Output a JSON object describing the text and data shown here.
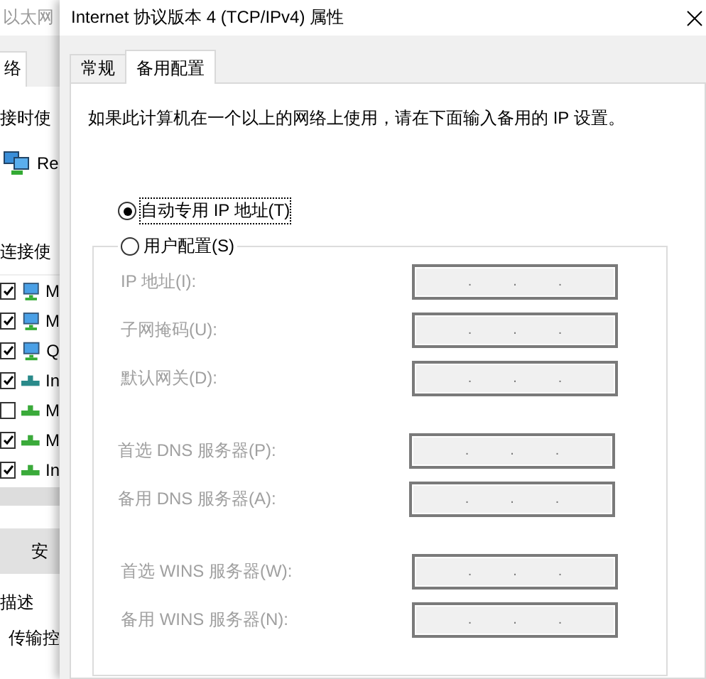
{
  "background_window": {
    "title": "以太网",
    "tab": "络",
    "connect_label": "接时使",
    "adapter": "Re",
    "items_label": "连接使",
    "items": [
      {
        "label": "M",
        "checked": true,
        "kind": "client"
      },
      {
        "label": "M",
        "checked": true,
        "kind": "client"
      },
      {
        "label": "Q",
        "checked": true,
        "kind": "client"
      },
      {
        "label": "In",
        "checked": true,
        "kind": "protocol-teal"
      },
      {
        "label": "M",
        "checked": false,
        "kind": "protocol"
      },
      {
        "label": "M",
        "checked": true,
        "kind": "protocol"
      },
      {
        "label": "In",
        "checked": true,
        "kind": "protocol"
      }
    ],
    "install_button": "安",
    "description_heading": "描述",
    "description": "传输控"
  },
  "dialog": {
    "title": "Internet 协议版本 4 (TCP/IPv4) 属性",
    "tabs": [
      {
        "label": "常规",
        "selected": false
      },
      {
        "label": "备用配置",
        "selected": true
      }
    ],
    "intro": "如果此计算机在一个以上的网络上使用，请在下面输入备用的 IP 设置。",
    "options": [
      {
        "label": "自动专用 IP 地址(T)",
        "selected": true
      },
      {
        "label": "用户配置(S)",
        "selected": false
      }
    ],
    "ip_separator": ".",
    "field_groups": [
      {
        "fields": [
          {
            "label": "IP 地址(I):",
            "disabled": true
          },
          {
            "label": "子网掩码(U):",
            "disabled": true
          },
          {
            "label": "默认网关(D):",
            "disabled": true
          }
        ]
      },
      {
        "fields": [
          {
            "label": "首选 DNS 服务器(P):",
            "disabled": true
          },
          {
            "label": "备用 DNS 服务器(A):",
            "disabled": true
          }
        ]
      },
      {
        "fields": [
          {
            "label": "首选 WINS 服务器(W):",
            "disabled": true
          },
          {
            "label": "备用 WINS 服务器(N):",
            "disabled": true
          }
        ]
      }
    ]
  }
}
